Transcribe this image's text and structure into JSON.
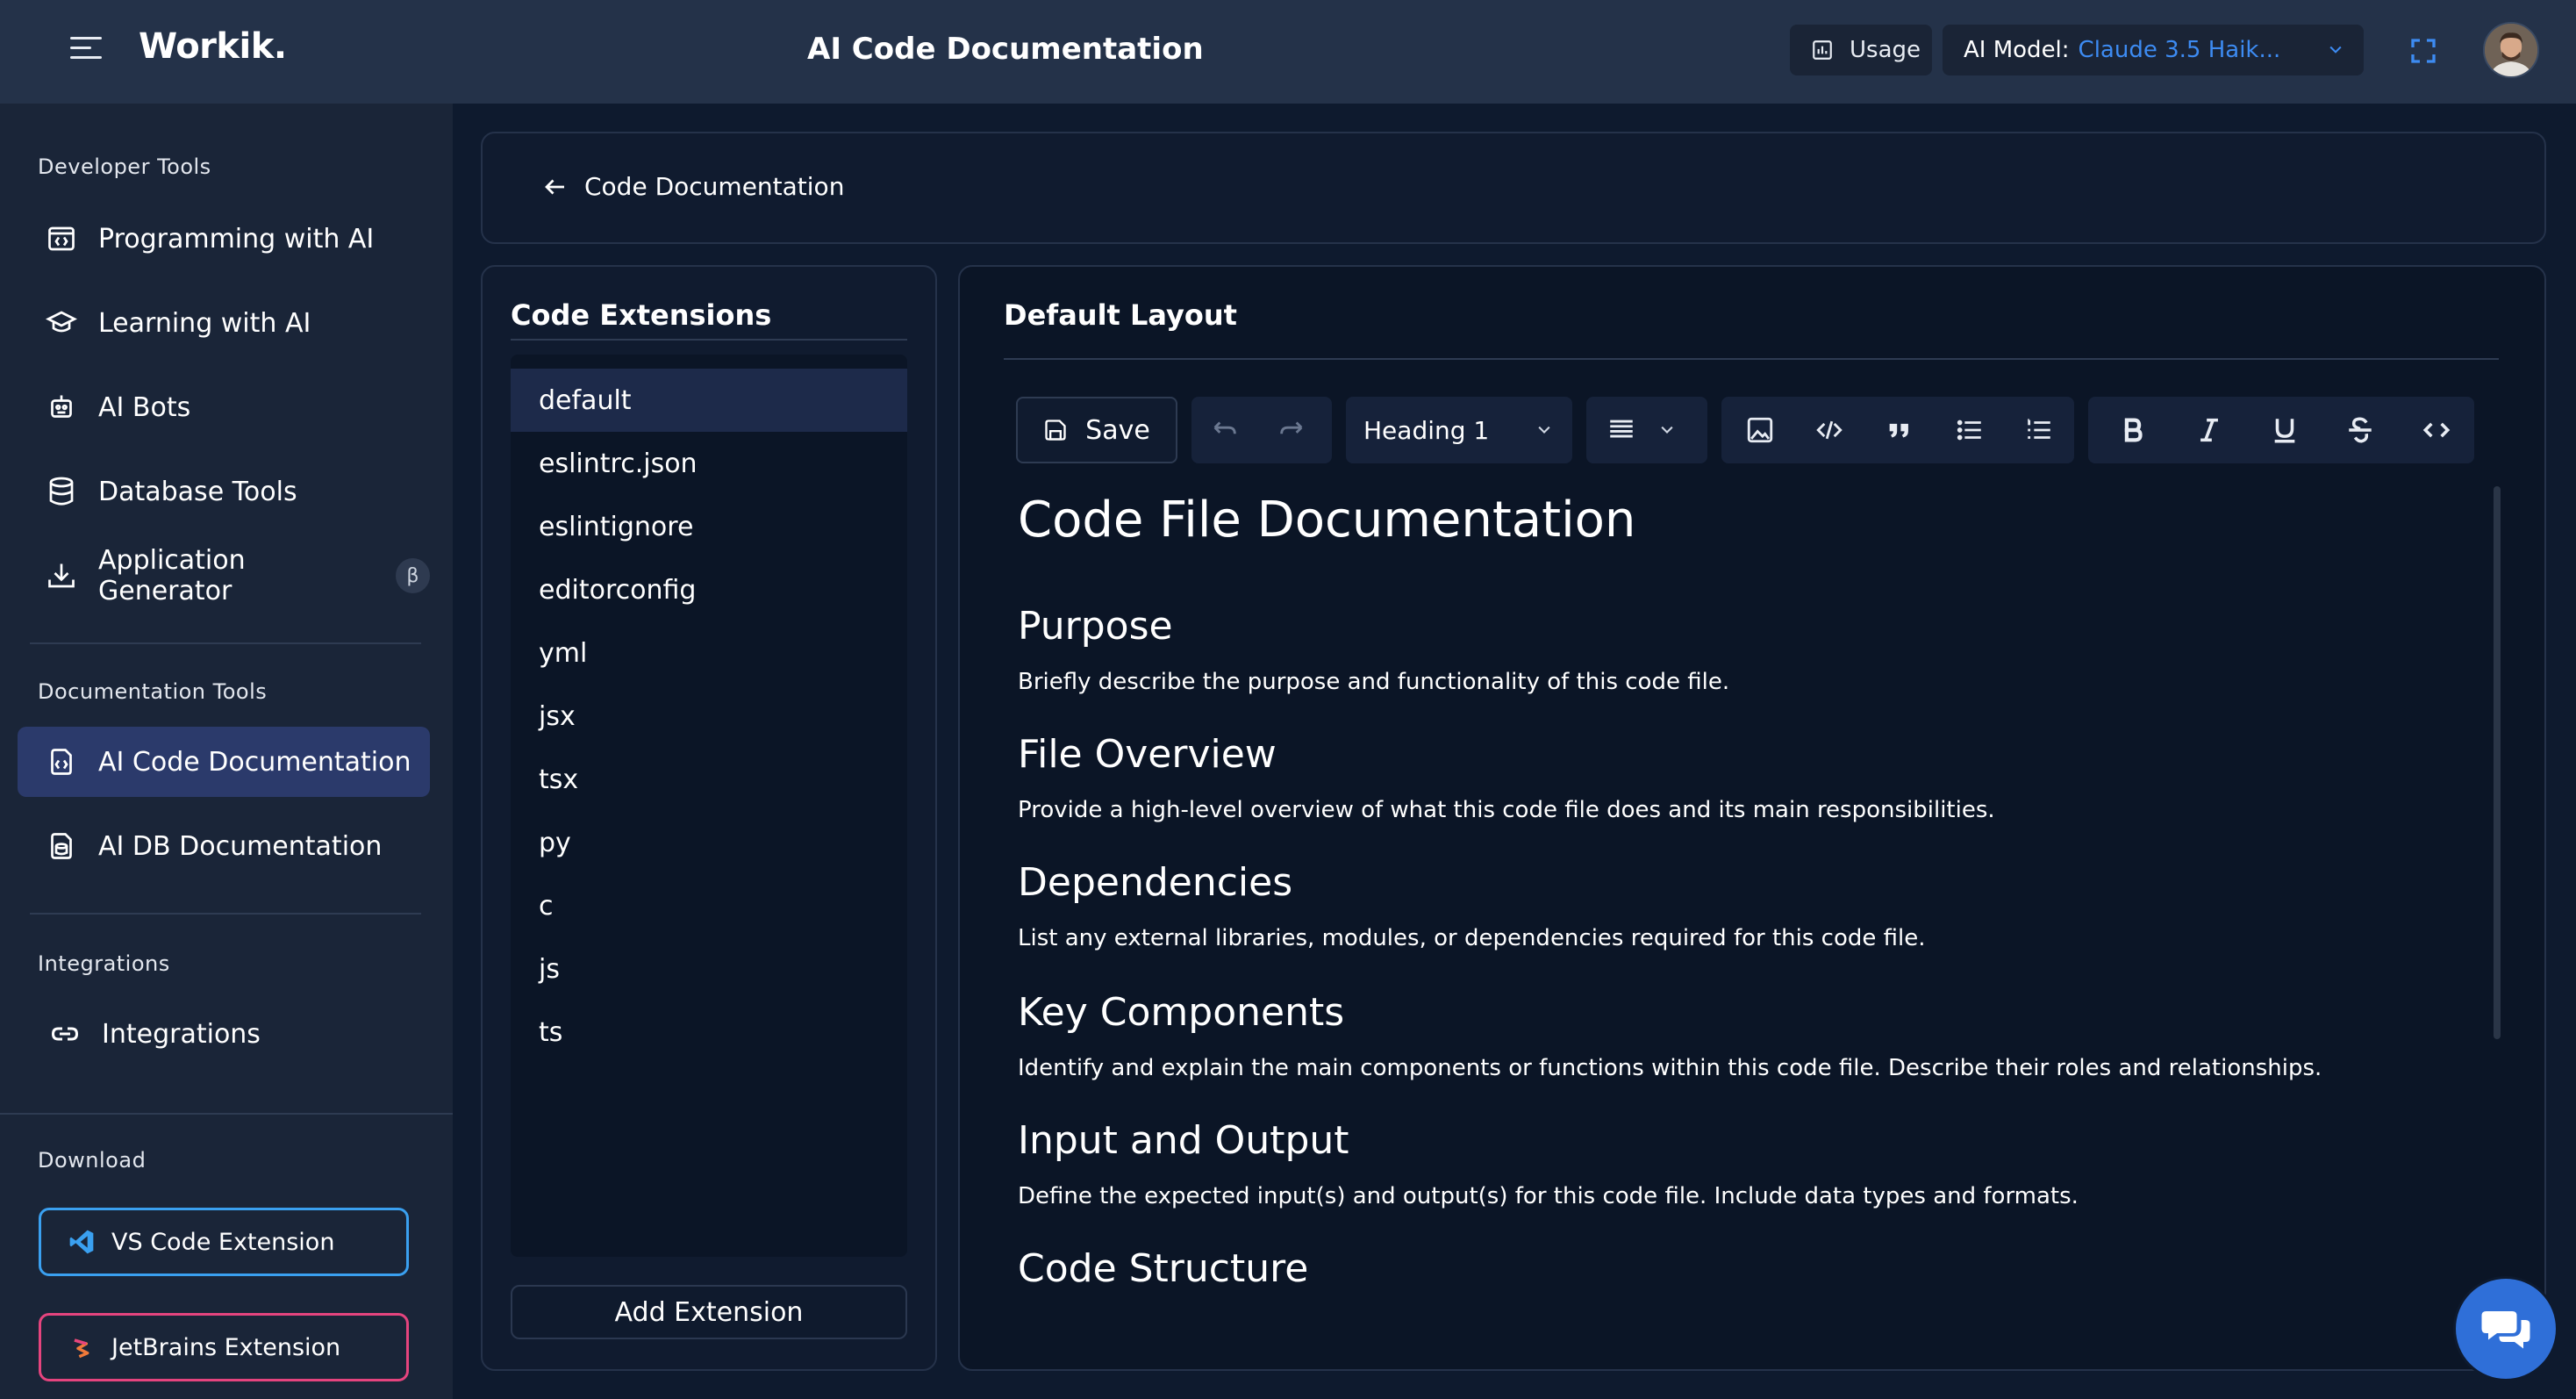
{
  "header": {
    "logo": "Workik.",
    "title": "AI Code Documentation",
    "usage_label": "Usage",
    "model_label": "AI Model:",
    "model_value": "Claude 3.5 Haik..."
  },
  "sidebar": {
    "dev_tools_title": "Developer Tools",
    "dev_tools": [
      {
        "label": "Programming with AI",
        "icon": "code-window-icon"
      },
      {
        "label": "Learning with AI",
        "icon": "graduation-cap-icon"
      },
      {
        "label": "AI Bots",
        "icon": "bot-icon"
      },
      {
        "label": "Database Tools",
        "icon": "database-icon"
      },
      {
        "label": "Application Generator",
        "icon": "download-icon",
        "badge": "β"
      }
    ],
    "doc_tools_title": "Documentation Tools",
    "doc_tools": [
      {
        "label": "AI Code Documentation",
        "icon": "code-doc-icon",
        "active": true
      },
      {
        "label": "AI DB Documentation",
        "icon": "db-doc-icon"
      }
    ],
    "integrations_title": "Integrations",
    "integrations": [
      {
        "label": "Integrations",
        "icon": "link-icon"
      }
    ],
    "download_title": "Download",
    "vs_code_label": "VS Code Extension",
    "jetbrains_label": "JetBrains Extension"
  },
  "breadcrumb": {
    "back_label": "Code Documentation"
  },
  "extensions": {
    "title": "Code Extensions",
    "items": [
      "default",
      "eslintrc.json",
      "eslintignore",
      "editorconfig",
      "yml",
      "jsx",
      "tsx",
      "py",
      "c",
      "js",
      "ts"
    ],
    "selected": "default",
    "add_label": "Add Extension"
  },
  "editor": {
    "title": "Default Layout",
    "save_label": "Save",
    "heading_select": "Heading 1",
    "doc_title": "Code File Documentation",
    "sections": [
      {
        "heading": "Purpose",
        "text": "Briefly describe the purpose and functionality of this code file."
      },
      {
        "heading": "File Overview",
        "text": "Provide a high-level overview of what this code file does and its main responsibilities."
      },
      {
        "heading": "Dependencies",
        "text": "List any external libraries, modules, or dependencies required for this code file."
      },
      {
        "heading": "Key Components",
        "text": "Identify and explain the main components or functions within this code file. Describe their roles and relationships."
      },
      {
        "heading": "Input and Output",
        "text": "Define the expected input(s) and output(s) for this code file. Include data types and formats."
      },
      {
        "heading": "Code Structure",
        "text": ""
      }
    ]
  },
  "colors": {
    "accent": "#3d8bf2",
    "active_bg": "#2b3a6b",
    "vs_border": "#3aa0f0",
    "jetbrains_border": "#e5447e",
    "chat_bg": "#2f6fd8"
  }
}
